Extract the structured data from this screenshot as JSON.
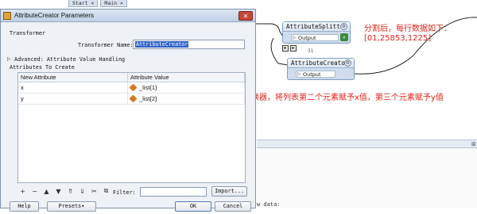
{
  "workspace": {
    "tabs": [
      "Start ×",
      "Main ×"
    ],
    "annotation_top": [
      "分割后，每行数据如下：",
      "[01,25853,1225]"
    ],
    "annotation_middle": "通过属性创建转换器，将列表第二个元素赋予x值，第三个元素赋予y值",
    "log_snippet": "w data:",
    "nodes": [
      {
        "name": "AttributeSplitter",
        "port": "Output"
      },
      {
        "name": "AttributeCreator",
        "port": "Output"
      }
    ],
    "feature_count": "31",
    "colors": {
      "annotation": "#e0211b",
      "node_fill": "#cfdcee"
    }
  },
  "dialog": {
    "title": "AttributeCreator Parameters",
    "section_title": "Transformer",
    "transformer_name_label": "Transformer Name:",
    "transformer_name_value": "AttributeCreator",
    "advanced_label": "Advanced: Attribute Value Handling",
    "attributes_label": "Attributes To Create",
    "table": {
      "headers": [
        "New Attribute",
        "Attribute Value"
      ],
      "rows": [
        {
          "attr": "x",
          "value": "_list{1}"
        },
        {
          "attr": "y",
          "value": "_list{2}"
        }
      ]
    },
    "toolbar": {
      "icons": [
        "+",
        "−",
        "▲",
        "▼",
        "⇑",
        "⇓",
        "✂",
        "⧉"
      ],
      "filter_label": "Filter:",
      "import_label": "Import..."
    },
    "buttons": {
      "help": "Help",
      "presets": "Presets▾",
      "ok": "OK",
      "cancel": "Cancel"
    }
  }
}
